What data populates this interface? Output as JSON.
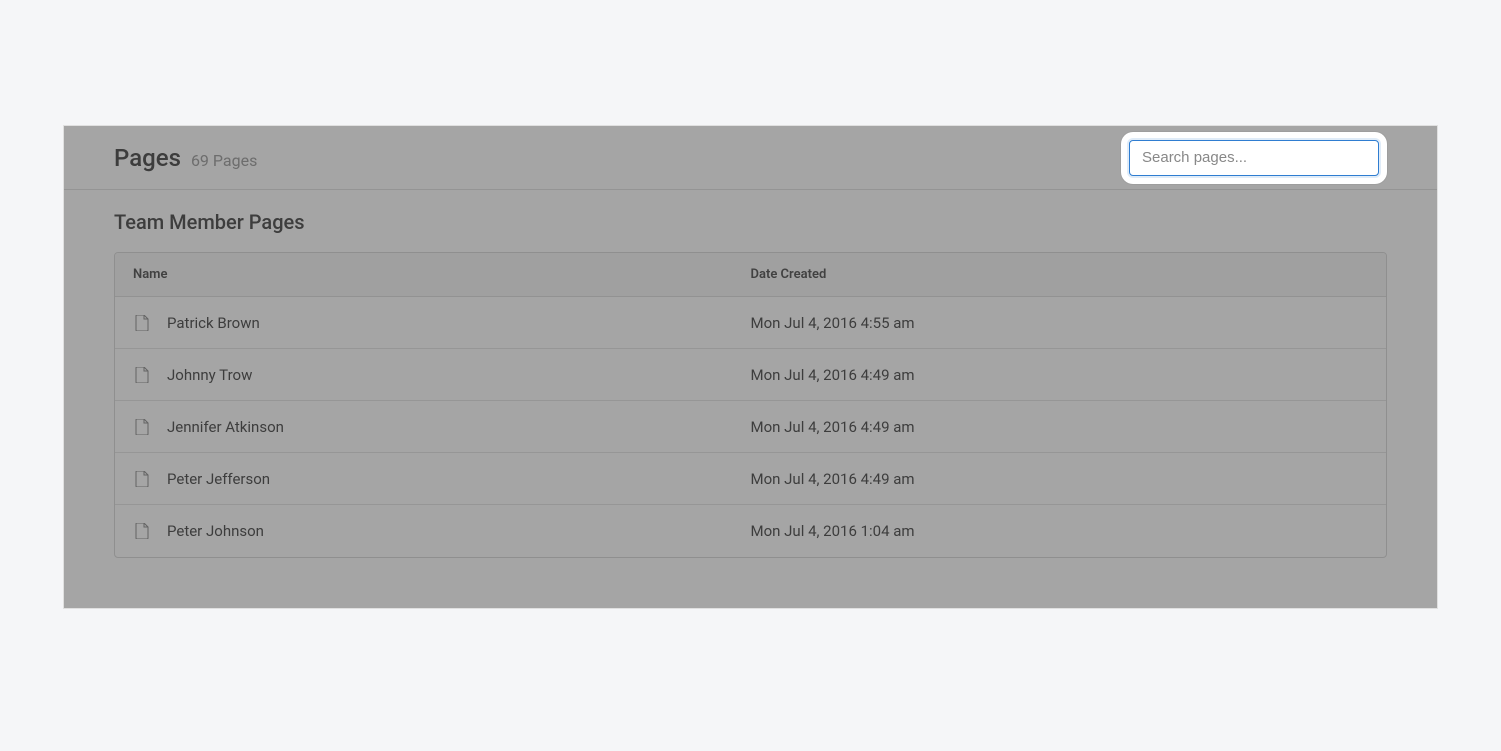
{
  "header": {
    "title": "Pages",
    "count_label": "69 Pages"
  },
  "search": {
    "placeholder": "Search pages...",
    "value": ""
  },
  "section": {
    "title": "Team Member Pages"
  },
  "table": {
    "columns": {
      "name": "Name",
      "date": "Date Created"
    },
    "rows": [
      {
        "name": "Patrick Brown",
        "date": "Mon Jul 4, 2016 4:55 am"
      },
      {
        "name": "Johnny Trow",
        "date": "Mon Jul 4, 2016 4:49 am"
      },
      {
        "name": "Jennifer Atkinson",
        "date": "Mon Jul 4, 2016 4:49 am"
      },
      {
        "name": "Peter Jefferson",
        "date": "Mon Jul 4, 2016 4:49 am"
      },
      {
        "name": "Peter Johnson",
        "date": "Mon Jul 4, 2016 1:04 am"
      }
    ]
  }
}
